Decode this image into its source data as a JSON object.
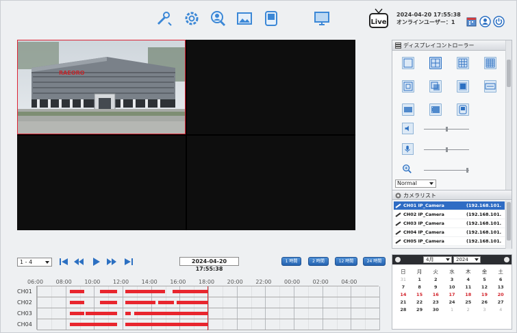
{
  "header": {
    "datetime": "2024-04-20 17:55:38",
    "online_users": "オンラインユーザー：1",
    "live_label": "Live",
    "toolbar_icons": [
      "tools-icon",
      "settings-gear-icon",
      "user-search-icon",
      "image-icon",
      "device-icon",
      "monitor-icon"
    ]
  },
  "video_grid": {
    "layout": "2x2",
    "active_cell": 1,
    "sign_text": "RAEORO"
  },
  "display_controller": {
    "title": "ディスプレイコントローラー",
    "selected_layout": "2x2",
    "slider_levels": [
      0.5,
      0.5,
      0.95
    ],
    "stream_mode": "Normal"
  },
  "camera_list": {
    "title": "カメラリスト",
    "items": [
      {
        "name": "CH01 IP_Camera",
        "ip": "(192.168.101.",
        "selected": true
      },
      {
        "name": "CH02 IP_Camera",
        "ip": "(192.168.101.",
        "selected": false
      },
      {
        "name": "CH03 IP_Camera",
        "ip": "(192.168.101.",
        "selected": false
      },
      {
        "name": "CH04 IP_Camera",
        "ip": "(192.168.101.",
        "selected": false
      },
      {
        "name": "CH05 IP_Camera",
        "ip": "(192.168.101.",
        "selected": false
      }
    ]
  },
  "playback": {
    "channel_range": "1 - 4",
    "current_time": "2024-04-20 17:55:38",
    "zoom_buttons": [
      "1 時間",
      "2 時間",
      "12 時間",
      "24 時間"
    ]
  },
  "timeline": {
    "hours": [
      "06:00",
      "08:00",
      "10:00",
      "12:00",
      "14:00",
      "16:00",
      "18:00",
      "20:00",
      "22:00",
      "00:00",
      "02:00",
      "04:00"
    ],
    "channels": [
      "CH01",
      "CH02",
      "CH03",
      "CH04"
    ],
    "cursor_hour": 17.93,
    "recordings": [
      [
        [
          8.3,
          9.3
        ],
        [
          10.4,
          11.6
        ],
        [
          12.2,
          15.0
        ],
        [
          15.5,
          18.0
        ]
      ],
      [
        [
          8.3,
          9.3
        ],
        [
          10.4,
          11.6
        ],
        [
          12.2,
          14.3
        ],
        [
          14.5,
          15.6
        ],
        [
          15.8,
          18.0
        ]
      ],
      [
        [
          8.3,
          9.3
        ],
        [
          9.4,
          11.6
        ],
        [
          12.2,
          12.6
        ],
        [
          12.8,
          18.0
        ]
      ],
      [
        [
          8.3,
          11.6
        ],
        [
          12.2,
          18.0
        ]
      ]
    ]
  },
  "calendar": {
    "month": "4月",
    "year": "2024",
    "weekdays": [
      "日",
      "月",
      "火",
      "水",
      "木",
      "金",
      "土"
    ],
    "weeks": [
      [
        "31",
        "1",
        "2",
        "3",
        "4",
        "5",
        "6"
      ],
      [
        "7",
        "8",
        "9",
        "10",
        "11",
        "12",
        "13"
      ],
      [
        "14",
        "15",
        "16",
        "17",
        "18",
        "19",
        "20"
      ],
      [
        "21",
        "22",
        "23",
        "24",
        "25",
        "26",
        "27"
      ],
      [
        "28",
        "29",
        "30",
        "1",
        "2",
        "3",
        "4"
      ]
    ],
    "recorded_days": [
      "14",
      "15",
      "16",
      "17",
      "18",
      "19",
      "20"
    ]
  },
  "colors": {
    "accent": "#2f6cc4",
    "record_red": "#e8262e",
    "video_bg": "#0e0e0e"
  }
}
